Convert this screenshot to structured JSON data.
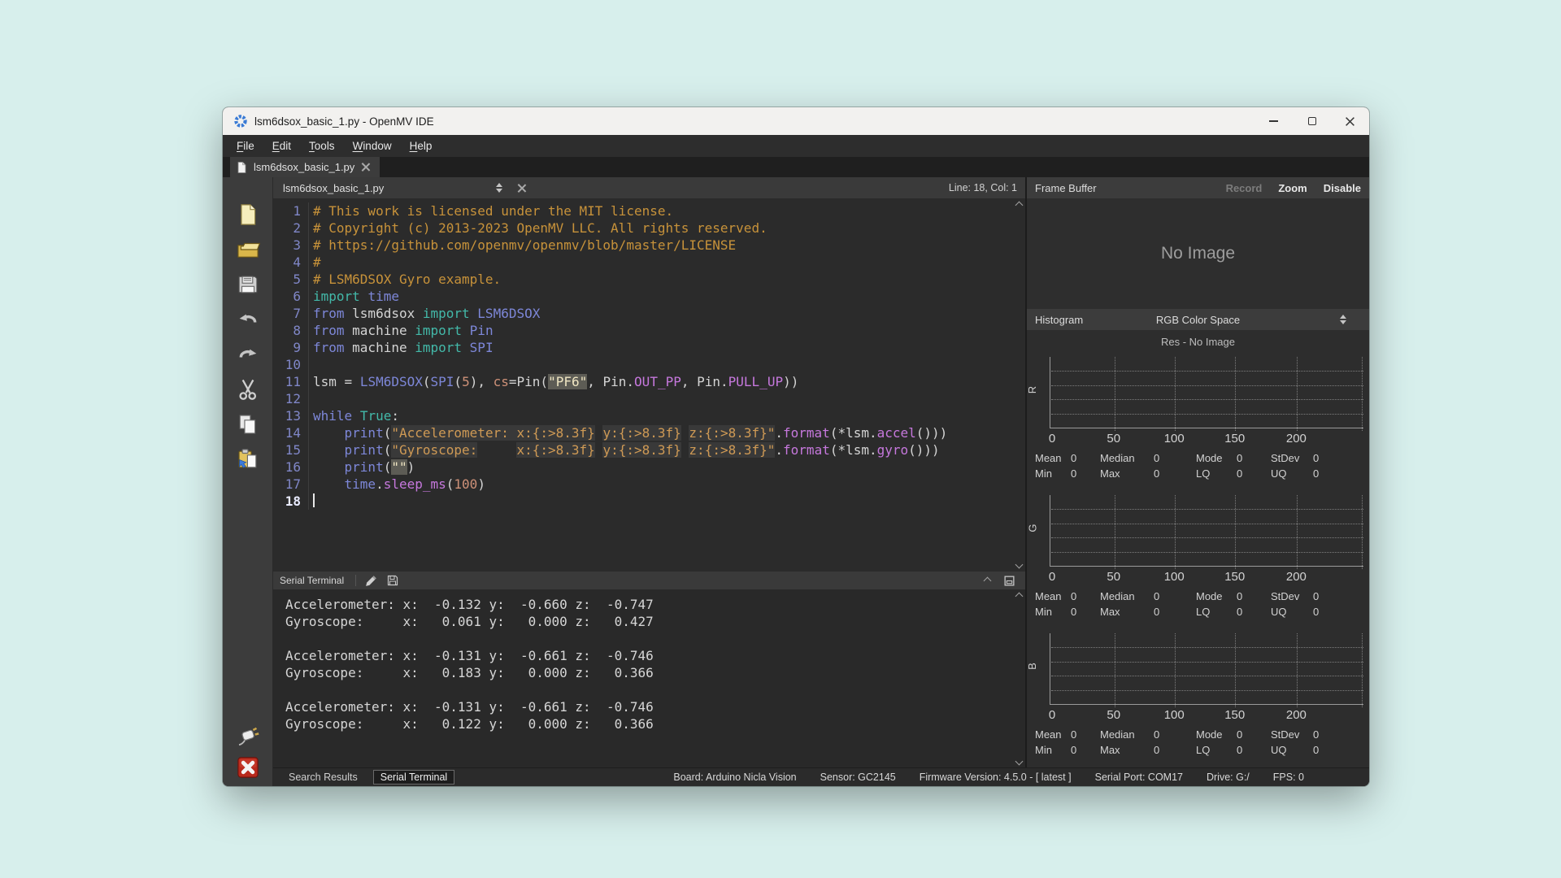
{
  "window": {
    "title": "lsm6dsox_basic_1.py - OpenMV IDE"
  },
  "menu": {
    "items": [
      "File",
      "Edit",
      "Tools",
      "Window",
      "Help"
    ]
  },
  "tab": {
    "label": "lsm6dsox_basic_1.py"
  },
  "editor": {
    "doc_selector": "lsm6dsox_basic_1.py",
    "cursor_status": "Line: 18, Col: 1",
    "code_lines": [
      {
        "n": "1",
        "tk": [
          [
            "# This work is licensed under the MIT license.",
            "com"
          ]
        ]
      },
      {
        "n": "2",
        "tk": [
          [
            "# Copyright (c) 2013-2023 OpenMV LLC. All rights reserved.",
            "com"
          ]
        ]
      },
      {
        "n": "3",
        "tk": [
          [
            "# https://github.com/openmv/openmv/blob/master/LICENSE",
            "com"
          ]
        ]
      },
      {
        "n": "4",
        "tk": [
          [
            "#",
            "com"
          ]
        ]
      },
      {
        "n": "5",
        "tk": [
          [
            "# LSM6DSOX Gyro example.",
            "com"
          ]
        ]
      },
      {
        "n": "6",
        "tk": [
          [
            "import",
            "imp"
          ],
          [
            " ",
            "pln"
          ],
          [
            "time",
            "kw"
          ]
        ]
      },
      {
        "n": "7",
        "tk": [
          [
            "from",
            "kw"
          ],
          [
            " lsm6dsox ",
            "pln"
          ],
          [
            "import",
            "imp"
          ],
          [
            " ",
            "pln"
          ],
          [
            "LSM6DSOX",
            "kw"
          ]
        ]
      },
      {
        "n": "8",
        "tk": [
          [
            "from",
            "kw"
          ],
          [
            " machine ",
            "pln"
          ],
          [
            "import",
            "imp"
          ],
          [
            " ",
            "pln"
          ],
          [
            "Pin",
            "kw"
          ]
        ]
      },
      {
        "n": "9",
        "tk": [
          [
            "from",
            "kw"
          ],
          [
            " machine ",
            "pln"
          ],
          [
            "import",
            "imp"
          ],
          [
            " ",
            "pln"
          ],
          [
            "SPI",
            "kw"
          ]
        ]
      },
      {
        "n": "10",
        "tk": []
      },
      {
        "n": "11",
        "tk": [
          [
            "lsm",
            "pln"
          ],
          [
            " = ",
            "pln"
          ],
          [
            "LSM6DSOX",
            "kw"
          ],
          [
            "(",
            "pln"
          ],
          [
            "SPI",
            "kw"
          ],
          [
            "(",
            "pln"
          ],
          [
            "5",
            "num"
          ],
          [
            "), ",
            "pln"
          ],
          [
            "cs",
            "par"
          ],
          [
            "=",
            "pln"
          ],
          [
            "Pin",
            "pln"
          ],
          [
            "(",
            "pln"
          ],
          [
            "\"PF6\"",
            "hl"
          ],
          [
            ", ",
            "pln"
          ],
          [
            "Pin",
            "pln"
          ],
          [
            ".",
            "pln"
          ],
          [
            "OUT_PP",
            "meth"
          ],
          [
            ", ",
            "pln"
          ],
          [
            "Pin",
            "pln"
          ],
          [
            ".",
            "pln"
          ],
          [
            "PULL_UP",
            "meth"
          ],
          [
            "))",
            "pln"
          ]
        ]
      },
      {
        "n": "12",
        "tk": []
      },
      {
        "n": "13",
        "tk": [
          [
            "while",
            "kw"
          ],
          [
            " ",
            "pln"
          ],
          [
            "True",
            "imp"
          ],
          [
            ":",
            "pln"
          ]
        ]
      },
      {
        "n": "14",
        "tk": [
          [
            "    ",
            "pln"
          ],
          [
            "print",
            "kw"
          ],
          [
            "(",
            "pln"
          ],
          [
            "\"Accelerometer: ",
            "strbox"
          ],
          [
            "x:{:>8.3f}",
            "strbox"
          ],
          [
            " ",
            "pln"
          ],
          [
            "y:{:>8.3f}",
            "strbox"
          ],
          [
            " ",
            "pln"
          ],
          [
            "z:{:>8.3f}\"",
            "strbox"
          ],
          [
            ".",
            "pln"
          ],
          [
            "format",
            "meth"
          ],
          [
            "(*lsm.",
            "pln"
          ],
          [
            "accel",
            "meth"
          ],
          [
            "()))",
            "pln"
          ]
        ]
      },
      {
        "n": "15",
        "tk": [
          [
            "    ",
            "pln"
          ],
          [
            "print",
            "kw"
          ],
          [
            "(",
            "pln"
          ],
          [
            "\"Gyroscope:",
            "strbox"
          ],
          [
            "     ",
            "str"
          ],
          [
            "x:{:>8.3f}",
            "strbox"
          ],
          [
            " ",
            "pln"
          ],
          [
            "y:{:>8.3f}",
            "strbox"
          ],
          [
            " ",
            "pln"
          ],
          [
            "z:{:>8.3f}\"",
            "strbox"
          ],
          [
            ".",
            "pln"
          ],
          [
            "format",
            "meth"
          ],
          [
            "(*lsm.",
            "pln"
          ],
          [
            "gyro",
            "meth"
          ],
          [
            "()))",
            "pln"
          ]
        ]
      },
      {
        "n": "16",
        "tk": [
          [
            "    ",
            "pln"
          ],
          [
            "print",
            "kw"
          ],
          [
            "(",
            "pln"
          ],
          [
            "\"\"",
            "hl"
          ],
          [
            ")",
            "pln"
          ]
        ]
      },
      {
        "n": "17",
        "tk": [
          [
            "    ",
            "pln"
          ],
          [
            "time",
            "kw"
          ],
          [
            ".",
            "pln"
          ],
          [
            "sleep_ms",
            "meth"
          ],
          [
            "(",
            "pln"
          ],
          [
            "100",
            "num"
          ],
          [
            ")",
            "pln"
          ]
        ]
      },
      {
        "n": "18",
        "tk": [],
        "cur": true
      }
    ]
  },
  "toolbar": {
    "items": [
      {
        "icon": "new-file-icon"
      },
      {
        "icon": "open-folder-icon"
      },
      {
        "icon": "save-icon"
      },
      {
        "icon": "undo-icon"
      },
      {
        "icon": "redo-icon"
      },
      {
        "icon": "cut-icon"
      },
      {
        "icon": "copy-icon"
      },
      {
        "icon": "paste-icon"
      }
    ],
    "bottom": [
      {
        "icon": "connect-icon"
      },
      {
        "icon": "stop-icon"
      }
    ]
  },
  "terminal": {
    "title": "Serial Terminal",
    "lines": [
      "Accelerometer: x:  -0.132 y:  -0.660 z:  -0.747",
      "Gyroscope:     x:   0.061 y:   0.000 z:   0.427",
      "",
      "Accelerometer: x:  -0.131 y:  -0.661 z:  -0.746",
      "Gyroscope:     x:   0.183 y:   0.000 z:   0.366",
      "",
      "Accelerometer: x:  -0.131 y:  -0.661 z:  -0.746",
      "Gyroscope:     x:   0.122 y:   0.000 z:   0.366"
    ]
  },
  "frame_buffer": {
    "title": "Frame Buffer",
    "actions": [
      {
        "label": "Record",
        "enabled": false
      },
      {
        "label": "Zoom",
        "enabled": true
      },
      {
        "label": "Disable",
        "enabled": true
      }
    ],
    "placeholder": "No Image"
  },
  "histogram": {
    "title": "Histogram",
    "color_space": "RGB Color Space",
    "res_label": "Res - No Image",
    "channels": [
      "R",
      "G",
      "B"
    ],
    "x_ticks": [
      "0",
      "50",
      "100",
      "150",
      "200"
    ],
    "stats": [
      {
        "label": "Mean",
        "value": "0"
      },
      {
        "label": "Median",
        "value": "0"
      },
      {
        "label": "Mode",
        "value": "0"
      },
      {
        "label": "StDev",
        "value": "0"
      },
      {
        "label": "Min",
        "value": "0"
      },
      {
        "label": "Max",
        "value": "0"
      },
      {
        "label": "LQ",
        "value": "0"
      },
      {
        "label": "UQ",
        "value": "0"
      }
    ]
  },
  "statusbar": {
    "tabs": [
      {
        "label": "Search Results",
        "active": false
      },
      {
        "label": "Serial Terminal",
        "active": true
      }
    ],
    "items": [
      "Board: Arduino Nicla Vision",
      "Sensor: GC2145",
      "Firmware Version: 4.5.0 - [ latest ]",
      "Serial Port: COM17",
      "Drive: G:/",
      "FPS: 0"
    ]
  },
  "colors": {
    "desktop_bg": "#d7efec",
    "accent_blue": "#3a7bd5",
    "stop_red": "#b8291c",
    "comment": "#c7923a",
    "keyword": "#7d87d8",
    "import_kw": "#43b9a9",
    "string": "#cf9a55",
    "method": "#c678dd"
  }
}
